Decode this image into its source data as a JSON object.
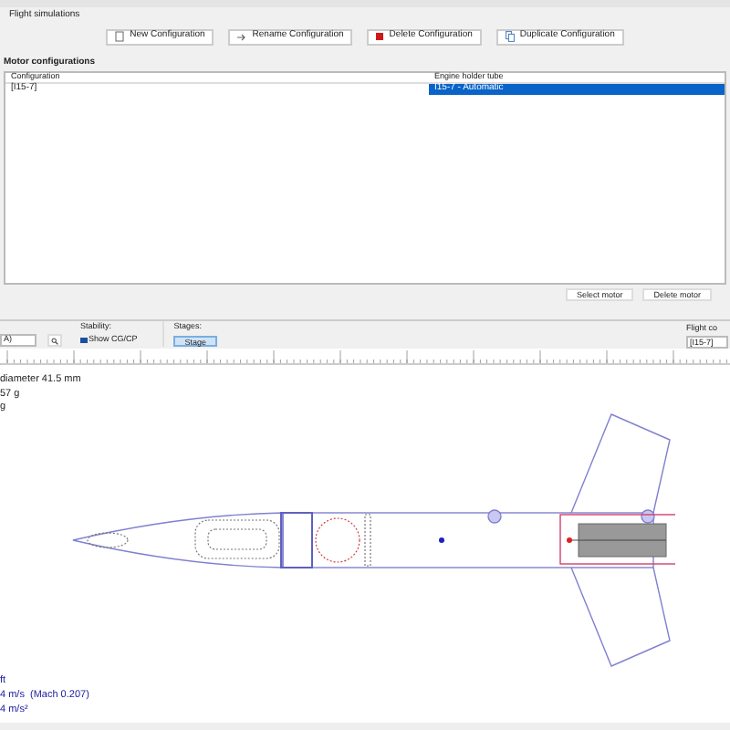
{
  "tab": {
    "label": "Flight simulations"
  },
  "config_buttons": [
    {
      "label": "New Configuration",
      "kind": "new"
    },
    {
      "label": "Rename Configuration",
      "kind": "rename"
    },
    {
      "label": "Delete Configuration",
      "kind": "delete"
    },
    {
      "label": "Duplicate Configuration",
      "kind": "duplicate"
    }
  ],
  "motor_configurations": {
    "title": "Motor configurations",
    "columns": [
      "Configuration",
      "Engine holder tube"
    ],
    "rows": [
      {
        "cells": [
          "[I15-7]",
          "I15-7 - Automatic"
        ],
        "selected": true
      }
    ],
    "buttons": [
      "Select motor",
      "Delete motor"
    ]
  },
  "toolbar": {
    "view_select": "A)",
    "stability_label": "Stability:",
    "show_cgcp": {
      "label": "Show CG/CP",
      "checked": true
    },
    "stages_label": "Stages:",
    "stages": [
      {
        "label": "Stage",
        "selected": true
      }
    ],
    "flight_label": "Flight co",
    "flight_value": "[I15-7]"
  },
  "info_top": [
    "diameter 41.5 mm",
    "57 g",
    "g"
  ],
  "info_bottom": [
    "ft",
    "4 m/s  (Mach 0.207)",
    "4 m/s²"
  ]
}
